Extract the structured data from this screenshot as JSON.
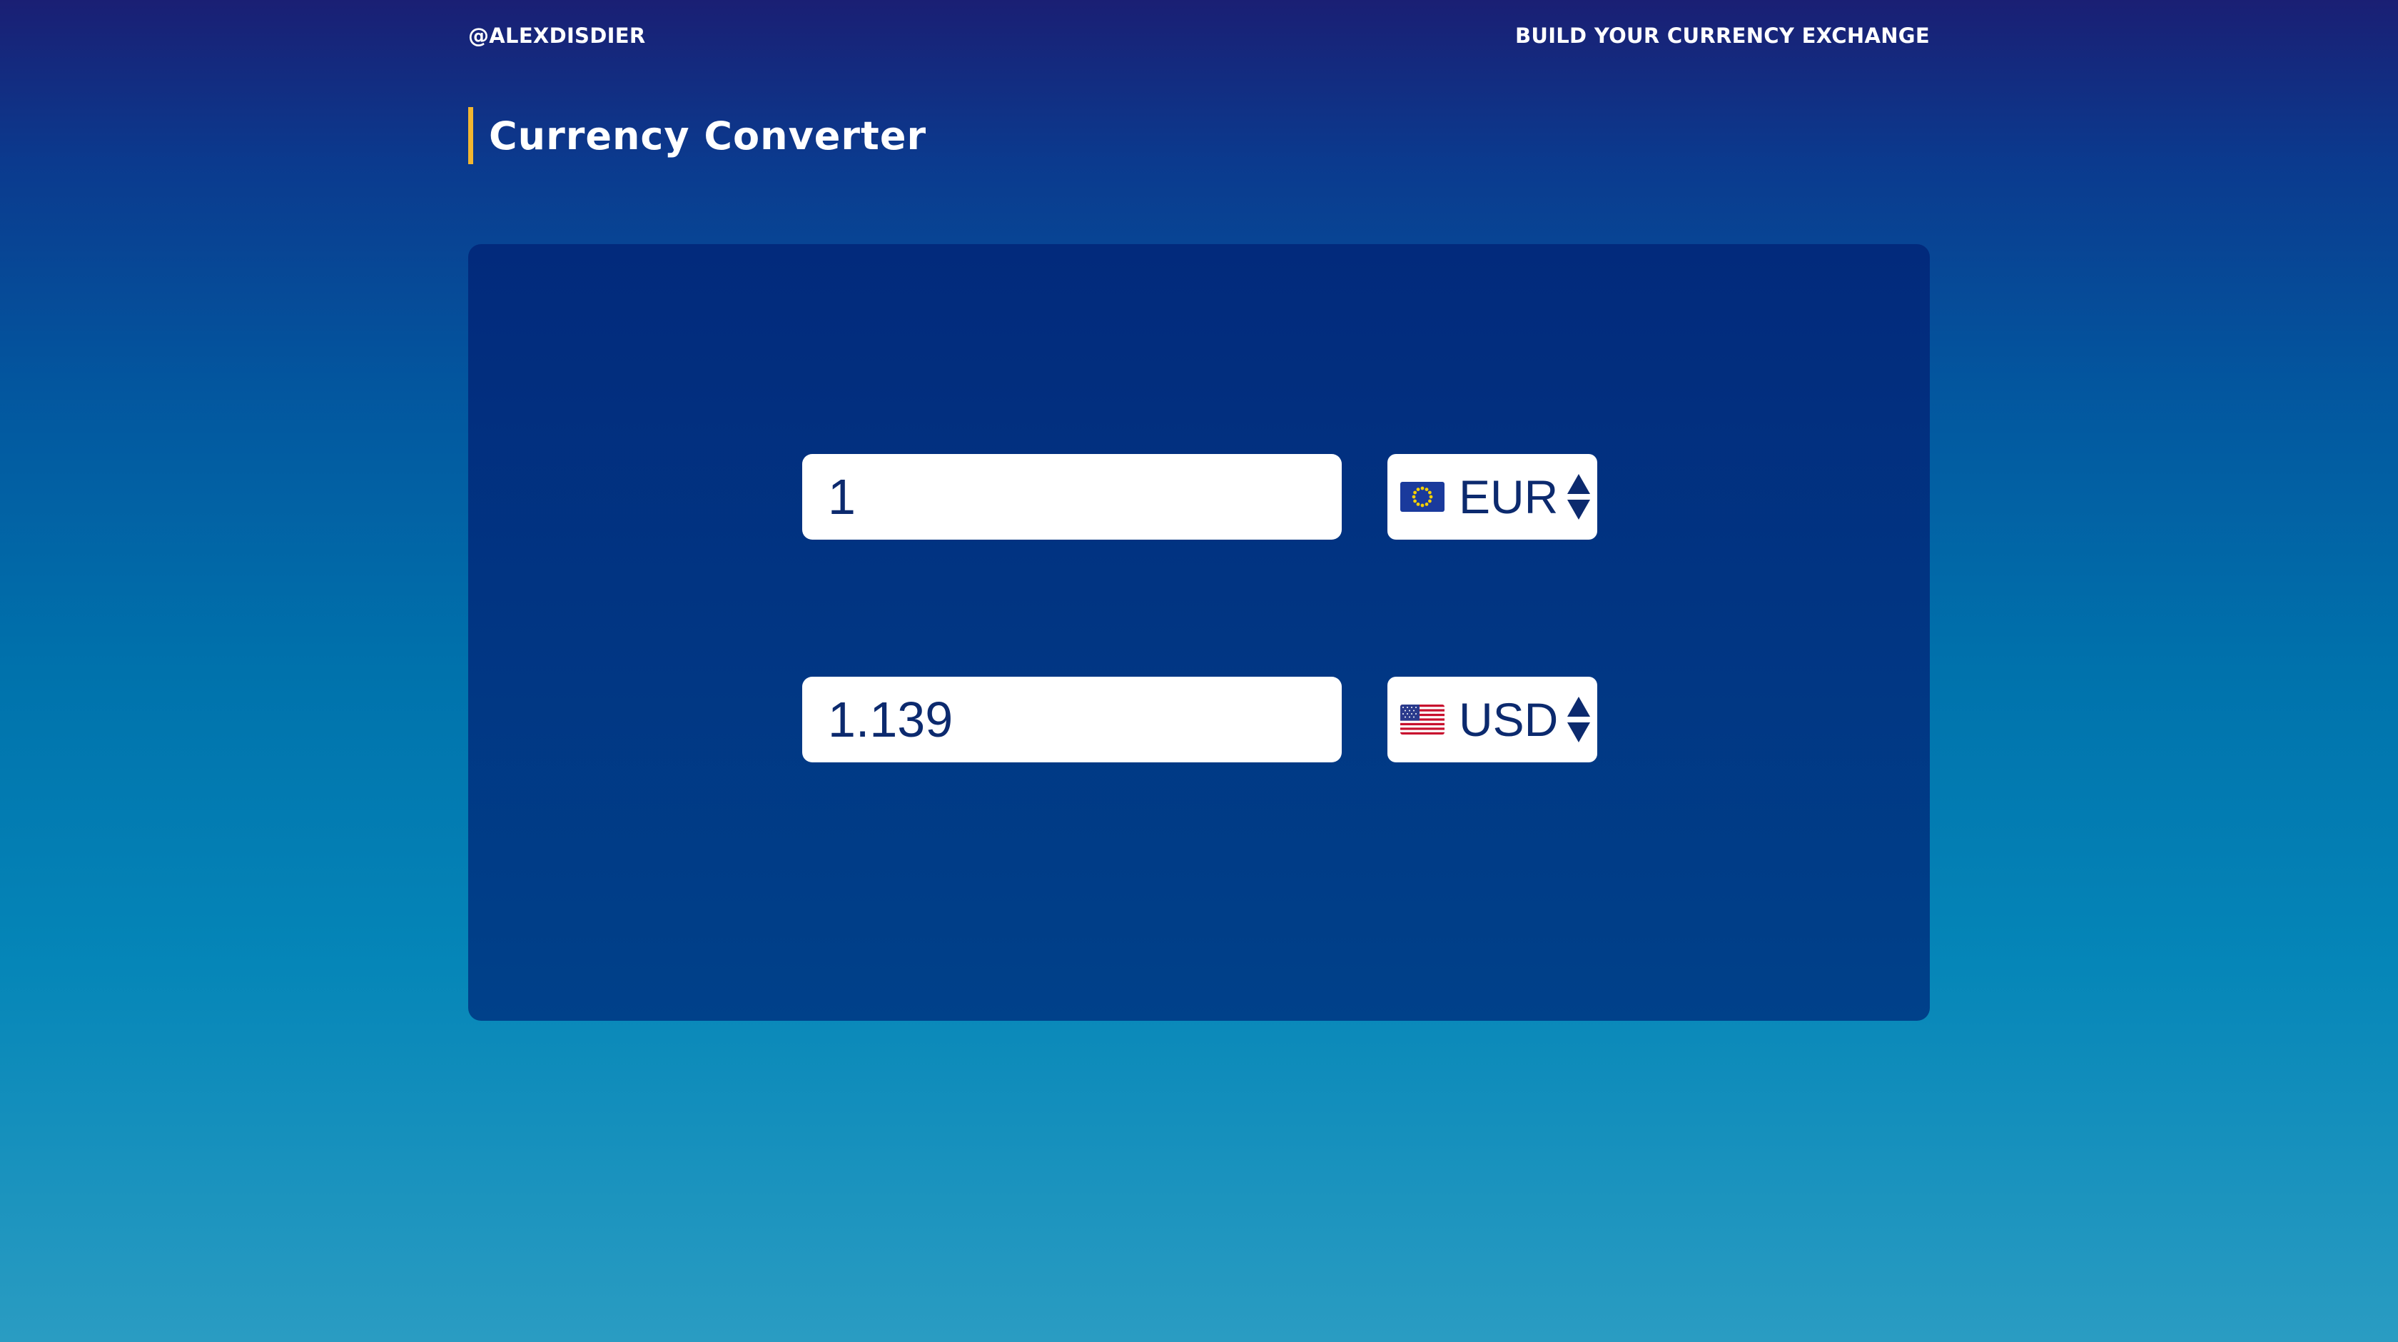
{
  "header": {
    "handle": "@ALEXDISDIER",
    "tagline": "BUILD YOUR CURRENCY EXCHANGE"
  },
  "page": {
    "title": "Currency Converter"
  },
  "converter": {
    "from": {
      "amount": "1",
      "currency": "EUR",
      "flag_icon": "eu-flag-icon"
    },
    "to": {
      "amount": "1.139",
      "currency": "USD",
      "flag_icon": "us-flag-icon"
    }
  },
  "colors": {
    "accent": "#f2b630",
    "text_dark": "#0c2a6e",
    "panel": "#022a7c"
  }
}
